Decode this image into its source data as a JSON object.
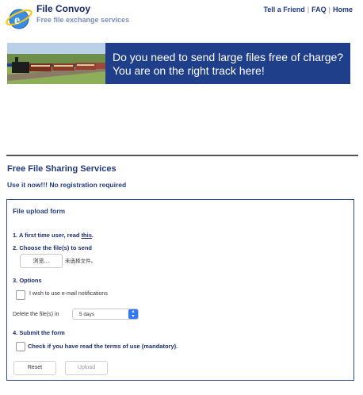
{
  "header": {
    "title": "File Convoy",
    "tagline": "Free file exchange services",
    "logo_icon": "e-globe-icon",
    "nav": [
      "Tell a Friend",
      "FAQ",
      "Home"
    ]
  },
  "banner": {
    "text": "Do you  need to send large files free of charge? You are on the right track here!"
  },
  "main": {
    "section_title": "Free File Sharing Services",
    "section_subtitle": "Use it now!!! No registration required"
  },
  "form": {
    "title": "File upload form",
    "step1_prefix": "1. A first time user, read ",
    "step1_link": "this",
    "step1_suffix": ".",
    "step2": "2. Choose the file(s) to send",
    "browse_label": "浏览...",
    "no_file": "未选择文件。",
    "step3": "3. Options",
    "email_option": "I wish to use e-mail notifications",
    "delete_label": "Delete the file(s) in",
    "delete_value": "5 days",
    "step4": "4. Submit the form",
    "terms_label": "Check if you have read the terms of use (mandatory).",
    "reset_label": "Reset",
    "upload_label": "Upload"
  },
  "colors": {
    "primary": "#1b2f6e",
    "banner_bg": "#1f3f8a",
    "select_accent": "#3478f6"
  }
}
